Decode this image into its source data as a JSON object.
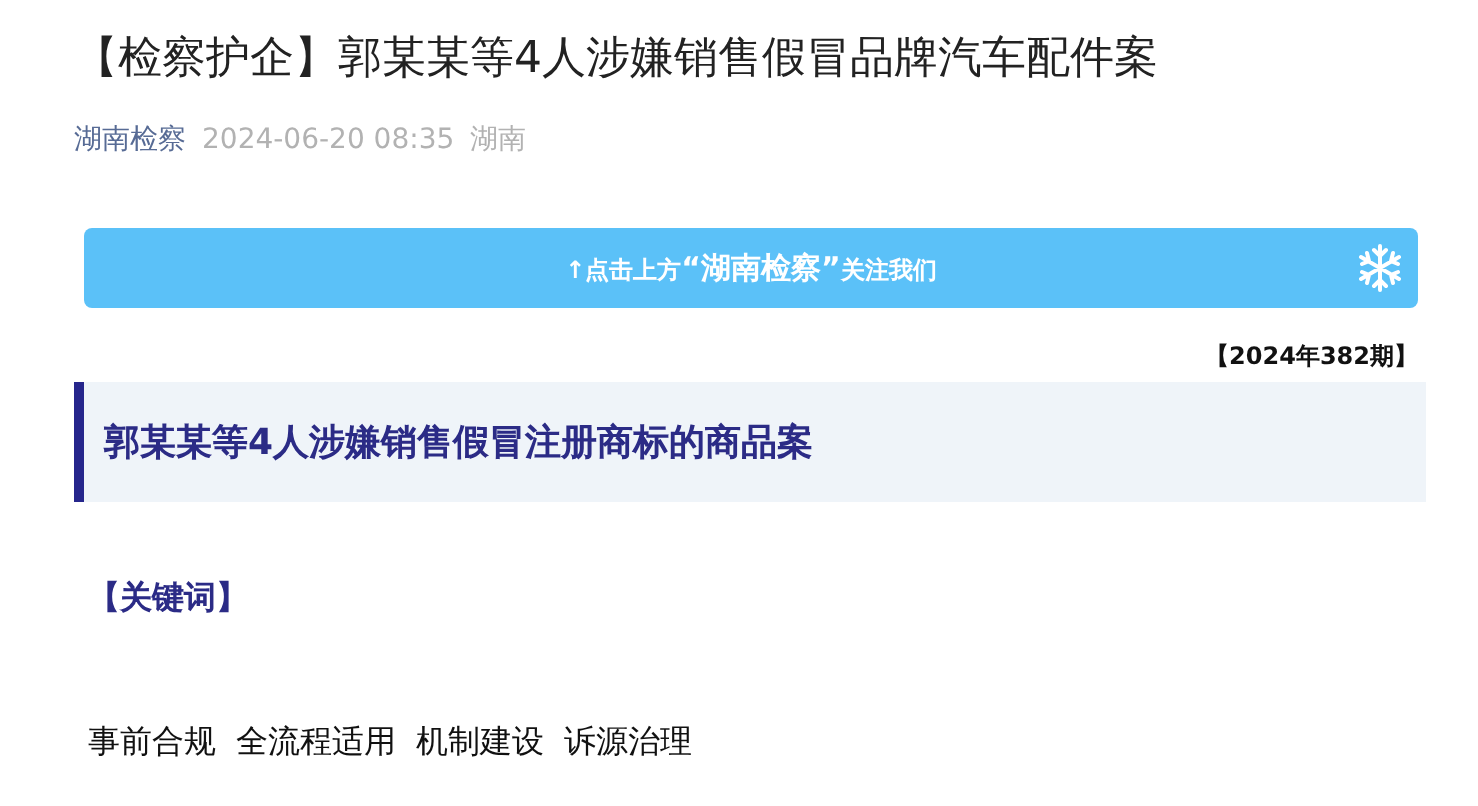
{
  "article": {
    "title": "【检察护企】郭某某等4人涉嫌销售假冒品牌汽车配件案",
    "account": "湖南检察",
    "date": "2024-06-20 08:35",
    "location": "湖南"
  },
  "banner": {
    "prefix": "↑点击上方",
    "highlight": "“湖南检察”",
    "suffix": "关注我们"
  },
  "issue": "【2024年382期】",
  "case_heading": "郭某某等4人涉嫌销售假冒注册商标的商品案",
  "keywords_label": "【关键词】",
  "keywords": [
    "事前合规",
    "全流程适用",
    "机制建设",
    "诉源治理"
  ]
}
